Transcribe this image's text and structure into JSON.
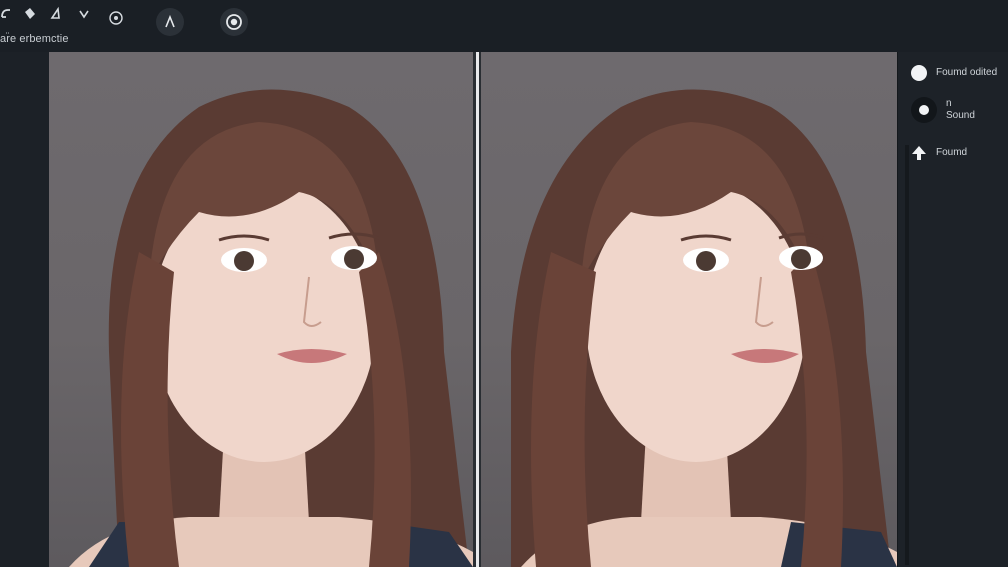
{
  "toolbar": {
    "status_label": "ar̈e erbemctie",
    "tools": [
      {
        "icon": "undo-arrow-icon"
      },
      {
        "icon": "diamond-icon"
      },
      {
        "icon": "triangle-icon"
      },
      {
        "icon": "chevron-down-icon"
      },
      {
        "icon": "target-icon"
      }
    ],
    "circle_buttons": [
      {
        "icon": "clock-hand-icon"
      },
      {
        "icon": "record-icon"
      }
    ]
  },
  "right_panel": {
    "items": [
      {
        "label": "Foumd odited",
        "icon": "filled-circle-icon"
      },
      {
        "label": "n\nSound",
        "icon": "dot-ring-icon"
      },
      {
        "label": "Foumd",
        "icon": "up-arrow-icon"
      }
    ]
  },
  "colors": {
    "background": "#1d2228",
    "accent": "#e9eaec"
  }
}
